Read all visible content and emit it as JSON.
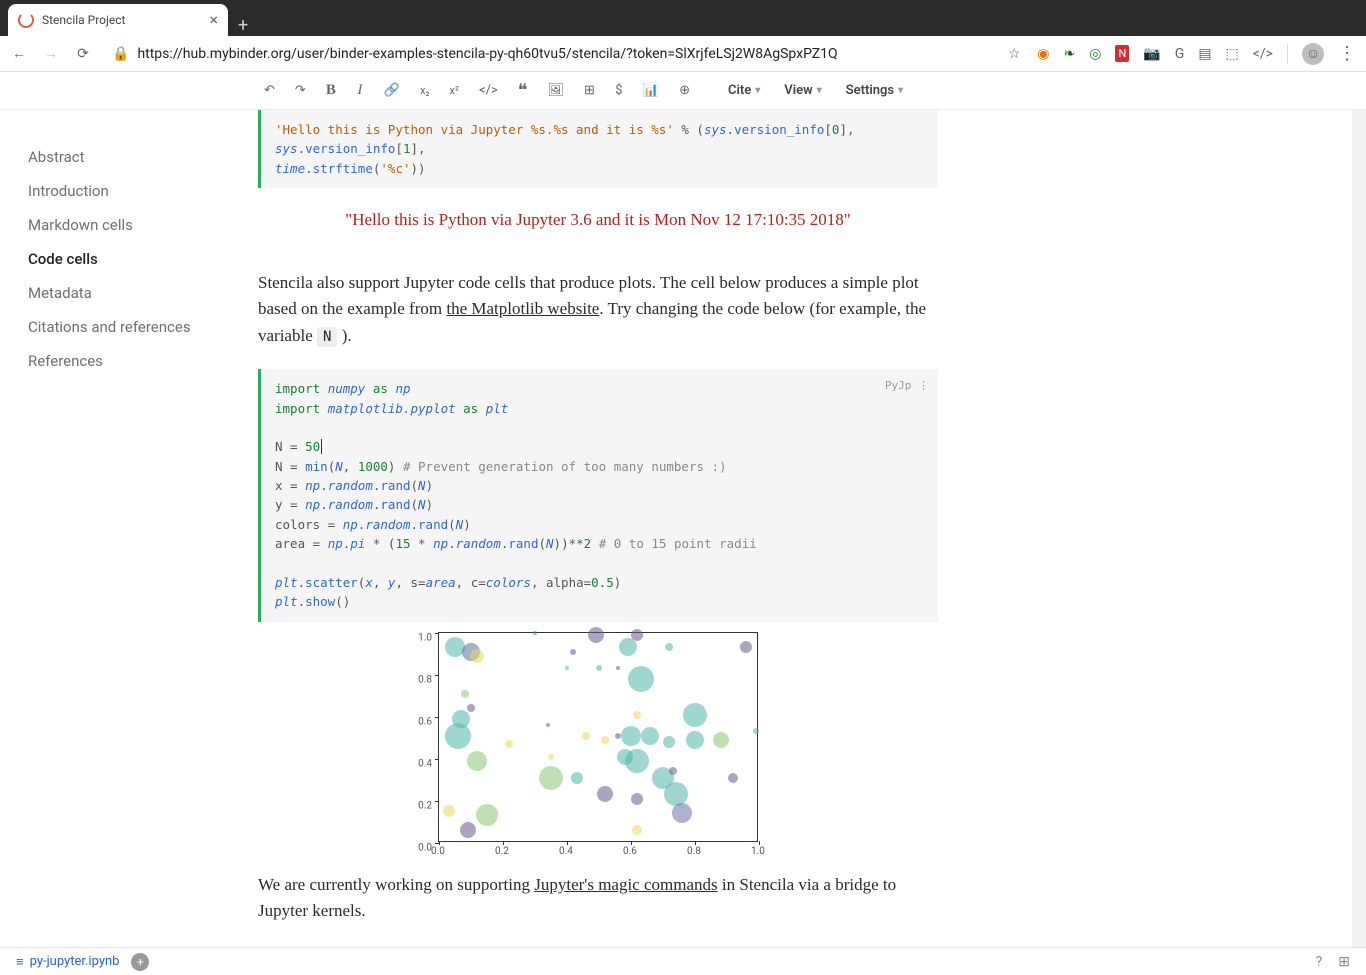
{
  "browser": {
    "tab_title": "Stencila Project",
    "url_display": "https://hub.mybinder.org/user/binder-examples-stencila-py-qh60tvu5/stencila/?token=SlXrjfeLSj2W8AgSpxPZ1Q"
  },
  "toolbar": {
    "cite": "Cite",
    "view": "View",
    "settings": "Settings"
  },
  "sidebar": {
    "items": [
      {
        "label": "Abstract",
        "active": false
      },
      {
        "label": "Introduction",
        "active": false
      },
      {
        "label": "Markdown cells",
        "active": false
      },
      {
        "label": "Code cells",
        "active": true
      },
      {
        "label": "Metadata",
        "active": false
      },
      {
        "label": "Citations and references",
        "active": false
      },
      {
        "label": "References",
        "active": false
      }
    ]
  },
  "cell1": {
    "line1a": "'Hello this is Python via Jupyter %s.%s and it is %s'",
    "line1b": " % (",
    "sv": "sys",
    "vi": "version_info",
    "line1c": "[",
    "idx0": "0",
    "line1d": "], ",
    "idx1": "1",
    "line1e": "],",
    "line2a": "time",
    "line2b": "strftime",
    "line2c": "(",
    "fmt": "'%c'",
    "line2d": "))"
  },
  "output1": "\"Hello this is Python via Jupyter 3.6 and it is Mon Nov 12 17:10:35 2018\"",
  "prose1": {
    "a": "Stencila also support Jupyter code cells that produce plots. The cell below produces a simple plot based on the example from ",
    "link": "the Matplotlib website",
    "b": ". Try changing the code below (for example, the variable ",
    "code": "N",
    "c": " )."
  },
  "cell2": {
    "badge": "PyJp",
    "l01_kw": "import",
    "l01_mod": "numpy",
    "l01_as": "as",
    "l01_al": "np",
    "l02_kw": "import",
    "l02_mod": "matplotlib.pyplot",
    "l02_as": "as",
    "l02_al": "plt",
    "l04": "N = ",
    "l04_v": "50",
    "l05a": "N = ",
    "l05_fn": "min",
    "l05b": "(",
    "l05_v": "N",
    "l05c": ", ",
    "l05_n": "1000",
    "l05d": ") ",
    "l05_cmt": "# Prevent generation of too many numbers :)",
    "l06a": "x = ",
    "l06_m": "np",
    "l06_r": "random",
    "l06_f": "rand",
    "l06b": "(",
    "l06_v": "N",
    "l06c": ")",
    "l07a": "y = ",
    "l07_m": "np",
    "l07_r": "random",
    "l07_f": "rand",
    "l07b": "(",
    "l07_v": "N",
    "l07c": ")",
    "l08a": "colors = ",
    "l08_m": "np",
    "l08_r": "random",
    "l08_f": "rand",
    "l08b": "(",
    "l08_v": "N",
    "l08c": ")",
    "l09a": "area = ",
    "l09_m": "np",
    "l09_pi": "pi",
    "l09b": " * (",
    "l09_n1": "15",
    "l09c": " * ",
    "l09_m2": "np",
    "l09_r2": "random",
    "l09_f2": "rand",
    "l09d": "(",
    "l09_v": "N",
    "l09e": "))**",
    "l09_n2": "2",
    "l09f": "  ",
    "l09_cmt": "# 0 to 15 point radii",
    "l11_m": "plt",
    "l11_f": "scatter",
    "l11a": "(",
    "l11_x": "x",
    "l11b": ", ",
    "l11_y": "y",
    "l11c": ", s=",
    "l11_s": "area",
    "l11d": ", c=",
    "l11_cl": "colors",
    "l11e": ", alpha=",
    "l11_al": "0.5",
    "l11f": ")",
    "l12_m": "plt",
    "l12_f": "show",
    "l12a": "()"
  },
  "chart_data": {
    "type": "scatter",
    "xlabel": "",
    "ylabel": "",
    "xlim": [
      0.0,
      1.0
    ],
    "ylim": [
      0.0,
      1.0
    ],
    "xticks": [
      "0.0",
      "0.2",
      "0.4",
      "0.6",
      "0.8",
      "1.0"
    ],
    "yticks": [
      "0.0",
      "0.2",
      "0.4",
      "0.6",
      "0.8",
      "1.0"
    ],
    "points": [
      {
        "x": 0.05,
        "y": 0.92,
        "r": 10,
        "c": "#4db6a7"
      },
      {
        "x": 0.1,
        "y": 0.9,
        "r": 9,
        "c": "#5b6f9c"
      },
      {
        "x": 0.12,
        "y": 0.88,
        "r": 7,
        "c": "#e7d95a"
      },
      {
        "x": 0.3,
        "y": 0.99,
        "r": 2,
        "c": "#3a8f7e"
      },
      {
        "x": 0.42,
        "y": 0.9,
        "r": 3,
        "c": "#6a5a8c"
      },
      {
        "x": 0.4,
        "y": 0.82,
        "r": 2,
        "c": "#4db6a7"
      },
      {
        "x": 0.49,
        "y": 0.98,
        "r": 8,
        "c": "#6a5a8c"
      },
      {
        "x": 0.5,
        "y": 0.82,
        "r": 3,
        "c": "#4db6a7"
      },
      {
        "x": 0.62,
        "y": 0.98,
        "r": 6,
        "c": "#6a5a8c"
      },
      {
        "x": 0.59,
        "y": 0.92,
        "r": 9,
        "c": "#4db6a7"
      },
      {
        "x": 0.56,
        "y": 0.82,
        "r": 2,
        "c": "#6a5a8c"
      },
      {
        "x": 0.63,
        "y": 0.77,
        "r": 13,
        "c": "#4db6a7"
      },
      {
        "x": 0.72,
        "y": 0.92,
        "r": 4,
        "c": "#4db6a7"
      },
      {
        "x": 0.96,
        "y": 0.92,
        "r": 6,
        "c": "#6a5a8c"
      },
      {
        "x": 0.08,
        "y": 0.7,
        "r": 4,
        "c": "#8bc76f"
      },
      {
        "x": 0.1,
        "y": 0.63,
        "r": 4,
        "c": "#6a5a8c"
      },
      {
        "x": 0.06,
        "y": 0.5,
        "r": 13,
        "c": "#4db6a7"
      },
      {
        "x": 0.07,
        "y": 0.58,
        "r": 9,
        "c": "#4db6a7"
      },
      {
        "x": 0.22,
        "y": 0.46,
        "r": 4,
        "c": "#e7d95a"
      },
      {
        "x": 0.12,
        "y": 0.38,
        "r": 10,
        "c": "#8bc76f"
      },
      {
        "x": 0.34,
        "y": 0.55,
        "r": 2,
        "c": "#6a5a8c"
      },
      {
        "x": 0.35,
        "y": 0.3,
        "r": 12,
        "c": "#8bc76f"
      },
      {
        "x": 0.43,
        "y": 0.3,
        "r": 6,
        "c": "#4db6a7"
      },
      {
        "x": 0.46,
        "y": 0.5,
        "r": 4,
        "c": "#e7d95a"
      },
      {
        "x": 0.52,
        "y": 0.48,
        "r": 4,
        "c": "#e7d95a"
      },
      {
        "x": 0.6,
        "y": 0.5,
        "r": 10,
        "c": "#4db6a7"
      },
      {
        "x": 0.62,
        "y": 0.38,
        "r": 12,
        "c": "#4db6a7"
      },
      {
        "x": 0.58,
        "y": 0.4,
        "r": 8,
        "c": "#4db6a7"
      },
      {
        "x": 0.56,
        "y": 0.5,
        "r": 3,
        "c": "#6a5a8c"
      },
      {
        "x": 0.62,
        "y": 0.6,
        "r": 4,
        "c": "#e7d95a"
      },
      {
        "x": 0.66,
        "y": 0.5,
        "r": 9,
        "c": "#4db6a7"
      },
      {
        "x": 0.72,
        "y": 0.47,
        "r": 6,
        "c": "#4db6a7"
      },
      {
        "x": 0.8,
        "y": 0.48,
        "r": 9,
        "c": "#4db6a7"
      },
      {
        "x": 0.88,
        "y": 0.48,
        "r": 8,
        "c": "#8bc76f"
      },
      {
        "x": 0.8,
        "y": 0.6,
        "r": 12,
        "c": "#4db6a7"
      },
      {
        "x": 0.7,
        "y": 0.3,
        "r": 11,
        "c": "#4db6a7"
      },
      {
        "x": 0.74,
        "y": 0.22,
        "r": 12,
        "c": "#4db6a7"
      },
      {
        "x": 0.76,
        "y": 0.13,
        "r": 10,
        "c": "#6f71a6"
      },
      {
        "x": 0.73,
        "y": 0.33,
        "r": 4,
        "c": "#6a5a8c"
      },
      {
        "x": 0.62,
        "y": 0.2,
        "r": 6,
        "c": "#6a5a8c"
      },
      {
        "x": 0.62,
        "y": 0.05,
        "r": 5,
        "c": "#e7d95a"
      },
      {
        "x": 0.52,
        "y": 0.22,
        "r": 8,
        "c": "#6a5a8c"
      },
      {
        "x": 0.35,
        "y": 0.4,
        "r": 3,
        "c": "#e7d95a"
      },
      {
        "x": 0.15,
        "y": 0.12,
        "r": 11,
        "c": "#8bc76f"
      },
      {
        "x": 0.09,
        "y": 0.05,
        "r": 8,
        "c": "#6a5a8c"
      },
      {
        "x": 0.03,
        "y": 0.14,
        "r": 6,
        "c": "#e7d95a"
      },
      {
        "x": 0.92,
        "y": 0.3,
        "r": 5,
        "c": "#6a5a8c"
      },
      {
        "x": 0.99,
        "y": 0.52,
        "r": 3,
        "c": "#4db6a7"
      }
    ]
  },
  "prose2": {
    "a": "We are currently working on supporting ",
    "link": "Jupyter's magic commands",
    "b": " in Stencila via a bridge to Jupyter kernels."
  },
  "bottom": {
    "filename": "py-jupyter.ipynb"
  }
}
